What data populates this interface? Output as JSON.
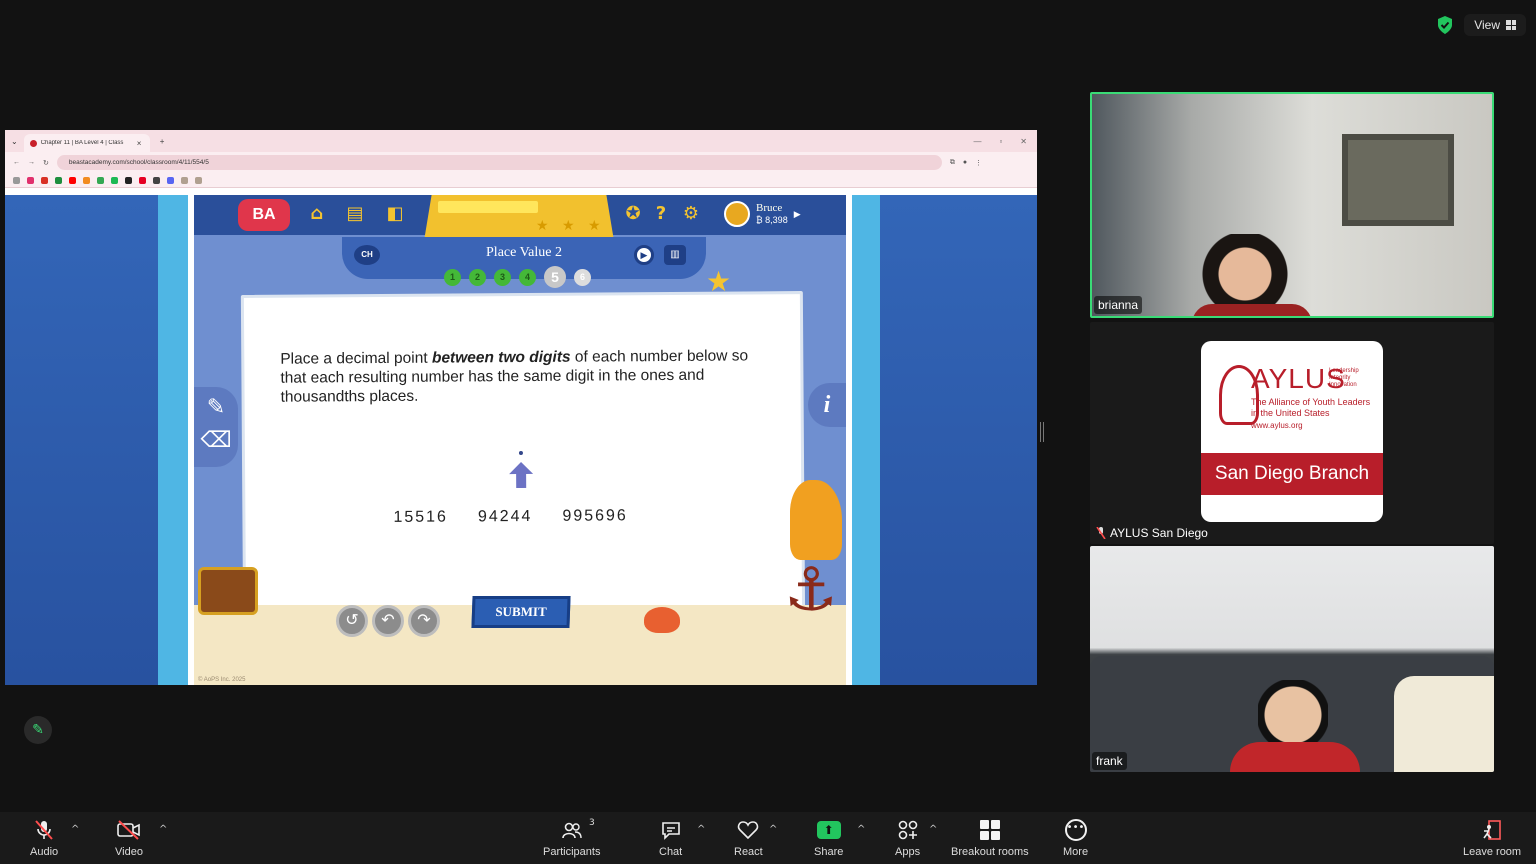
{
  "topbar": {
    "view_label": "View",
    "accent_green": "#3adb76"
  },
  "browser": {
    "tab_title": "Chapter 11 | BA Level 4 | Class",
    "url": "beastacademy.com/school/classroom/4/11/554/5"
  },
  "game": {
    "logo": "BA",
    "user_name": "Bruce",
    "user_coins": "8,398",
    "chapter_badge": "CH",
    "lesson_title": "Place Value 2",
    "steps": [
      "1",
      "2",
      "3",
      "4",
      "5",
      "6"
    ],
    "current_step": 5,
    "question_pre": "Place a decimal point ",
    "question_emph": "between two digits",
    "question_post": " of each number below so that each resulting number has the same digit in the ones and thousandths places.",
    "numbers": [
      "15516",
      "94244",
      "995696"
    ],
    "submit_label": "SUBMIT",
    "info_label": "i",
    "copyright": "© AoPS Inc. 2025"
  },
  "participants_video": [
    {
      "name": "brianna",
      "muted": false,
      "active_speaker": true
    },
    {
      "name": "AYLUS San Diego",
      "muted": true,
      "active_speaker": false
    },
    {
      "name": "frank",
      "muted": false,
      "active_speaker": false
    }
  ],
  "aylus": {
    "title": "AYLUS",
    "tag_line1": "Leadership",
    "tag_line2": "Integrity",
    "tag_line3": "Innovation",
    "sub_line1": "The Alliance of Youth Leaders",
    "sub_line2": "in the United States",
    "url": "www.aylus.org",
    "branch": "San Diego Branch"
  },
  "toolbar": {
    "audio": "Audio",
    "video": "Video",
    "participants": "Participants",
    "participants_count": "3",
    "chat": "Chat",
    "react": "React",
    "share": "Share",
    "apps": "Apps",
    "breakout": "Breakout rooms",
    "more": "More",
    "leave": "Leave room"
  }
}
